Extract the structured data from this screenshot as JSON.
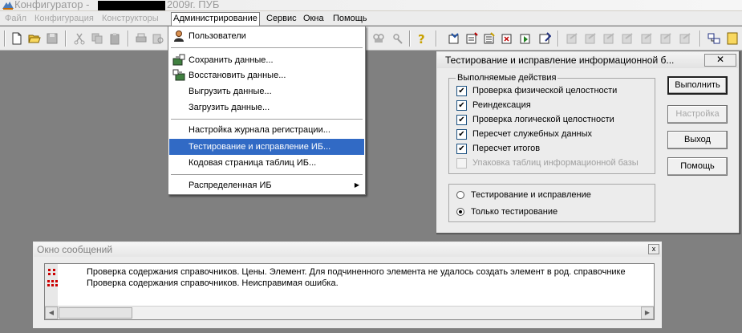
{
  "window": {
    "title": "Конфигуратор - ",
    "title_suffix": "2009г. ПУБ"
  },
  "menubar": [
    {
      "label": "Файл",
      "state": "disabled"
    },
    {
      "label": "Конфигурация",
      "state": "disabled"
    },
    {
      "label": "Конструкторы",
      "state": "disabled"
    },
    {
      "label": "Администрирование",
      "state": "open"
    },
    {
      "label": "Сервис",
      "state": "normal"
    },
    {
      "label": "Окна",
      "state": "normal"
    },
    {
      "label": "Помощь",
      "state": "normal"
    }
  ],
  "toolbar": {
    "icons": [
      "new-document-icon",
      "open-folder-icon",
      "save-icon",
      "cut-icon",
      "copy-icon",
      "paste-icon",
      "print-icon",
      "print-preview-icon",
      "find-icon",
      "replace-icon",
      "help-icon",
      "syntax-check-icon",
      "debugger-icon",
      "run-icon",
      "stop-icon",
      "window-icon"
    ]
  },
  "dropdown": {
    "items": [
      {
        "label": "Пользователи",
        "icon": "users-icon"
      },
      {
        "label": "Сохранить данные...",
        "icon": "save-data-icon"
      },
      {
        "label": "Восстановить данные...",
        "icon": "restore-data-icon"
      },
      {
        "label": "Выгрузить данные..."
      },
      {
        "label": "Загрузить данные..."
      },
      {
        "label": "Настройка журнала регистрации..."
      },
      {
        "label": "Тестирование и исправление ИБ...",
        "selected": true
      },
      {
        "label": "Кодовая страница таблиц ИБ..."
      },
      {
        "label": "Распределенная ИБ",
        "submenu": true
      }
    ],
    "submenu_arrow": "▶"
  },
  "dialog": {
    "title": "Тестирование и исправление информационной б...",
    "close_glyph": "✕",
    "actions_group": "Выполняемые действия",
    "checks": [
      {
        "label": "Проверка физической целостности",
        "checked": true
      },
      {
        "label": "Реиндексация",
        "checked": true
      },
      {
        "label": "Проверка логической целостности",
        "checked": true
      },
      {
        "label": "Пересчет служебных данных",
        "checked": true
      },
      {
        "label": "Пересчет итогов",
        "checked": true
      },
      {
        "label": "Упаковка таблиц информационной базы",
        "checked": false,
        "disabled": true
      }
    ],
    "check_mark": "✔",
    "radios": [
      {
        "label": "Тестирование и исправление",
        "checked": false
      },
      {
        "label": "Только тестирование",
        "checked": true
      }
    ],
    "buttons": [
      {
        "label": "Выполнить",
        "default": true
      },
      {
        "label": "Настройка",
        "disabled": true
      },
      {
        "label": "Выход"
      },
      {
        "label": "Помощь"
      }
    ]
  },
  "messages": {
    "title": "Окно сообщений",
    "close_glyph": "x",
    "rows": [
      {
        "text": "Проверка содержания справочников. Цены. Элемент. Для подчиненного элемента не удалось создать элемент в род. справочнике",
        "icon": "warning-icon"
      },
      {
        "text": "Проверка содержания справочников.  Неисправимая ошибка.",
        "icon": "error-icon"
      }
    ],
    "scroll_left": "◀",
    "scroll_right": "▶"
  },
  "colors": {
    "selection": "#316ac5",
    "desktop": "#808080",
    "message_icon": "#cc0000"
  }
}
